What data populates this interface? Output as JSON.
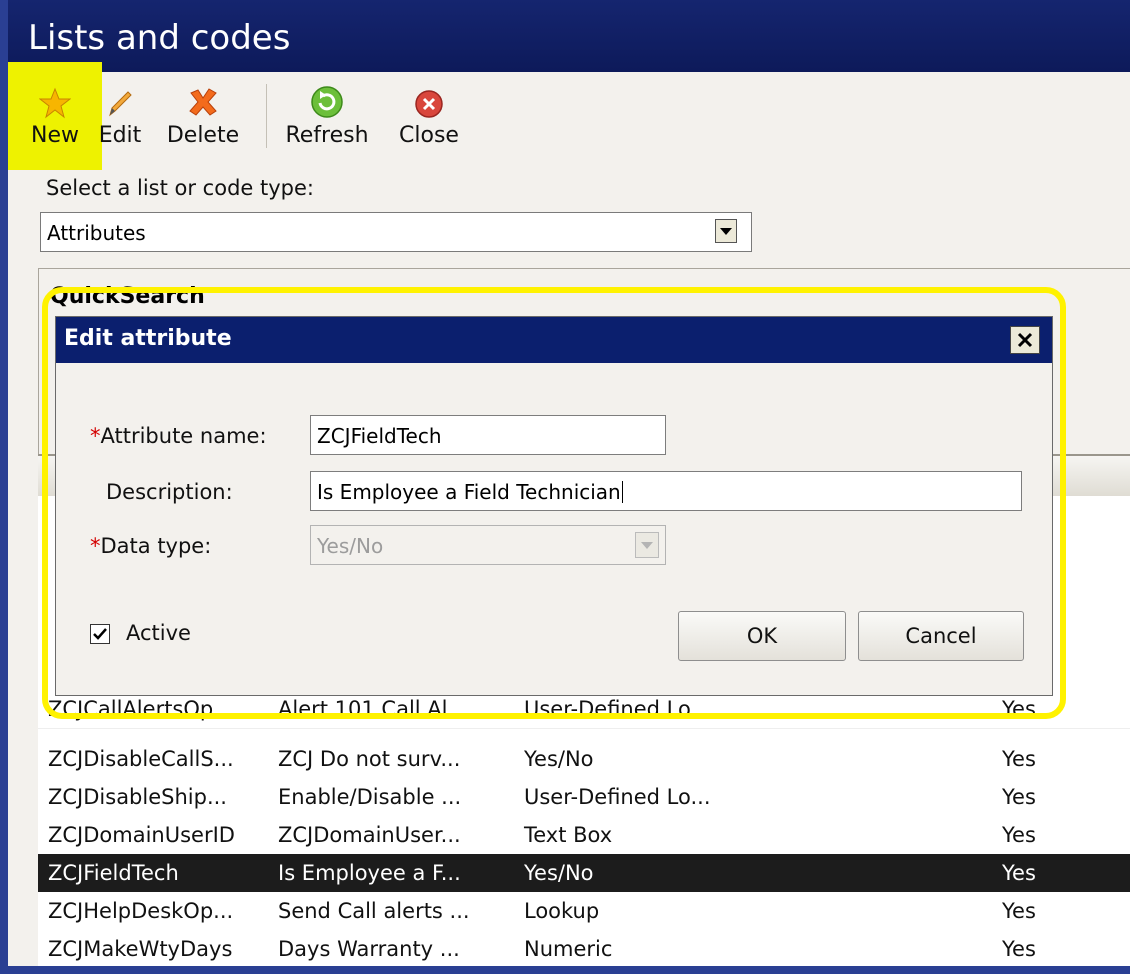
{
  "window": {
    "title": "Lists and codes"
  },
  "toolbar": {
    "new_label": "New",
    "edit_label": "Edit",
    "delete_label": "Delete",
    "refresh_label": "Refresh",
    "close_label": "Close"
  },
  "selector": {
    "label": "Select a list or code type:",
    "value": "Attributes"
  },
  "quicksearch": {
    "label": "QuickSearch"
  },
  "grid": {
    "rows": [
      {
        "c1": "ZCJCallAlertsOp...",
        "c2": "Alert 101 Call Al...",
        "c3": "User-Defined Lo...",
        "c4": "Yes",
        "selected": false
      },
      {
        "c1": "ZCJDisableCallS...",
        "c2": "ZCJ Do not surv...",
        "c3": "Yes/No",
        "c4": "Yes",
        "selected": false
      },
      {
        "c1": "ZCJDisableShip...",
        "c2": "Enable/Disable ...",
        "c3": "User-Defined Lo...",
        "c4": "Yes",
        "selected": false
      },
      {
        "c1": "ZCJDomainUserID",
        "c2": "ZCJDomainUser...",
        "c3": "Text Box",
        "c4": "Yes",
        "selected": false
      },
      {
        "c1": "ZCJFieldTech",
        "c2": "Is Employee a F...",
        "c3": "Yes/No",
        "c4": "Yes",
        "selected": true
      },
      {
        "c1": "ZCJHelpDeskOp...",
        "c2": "Send Call alerts ...",
        "c3": "Lookup",
        "c4": "Yes",
        "selected": false
      },
      {
        "c1": "ZCJMakeWtyDays",
        "c2": "Days Warranty ...",
        "c3": "Numeric",
        "c4": "Yes",
        "selected": false
      }
    ]
  },
  "dialog": {
    "title": "Edit attribute",
    "required_marker": "*",
    "name_label": "Attribute name:",
    "name_value": "ZCJFieldTech",
    "description_label": "Description:",
    "description_value": "Is Employee a Field Technician",
    "datatype_label": "Data type:",
    "datatype_value": "Yes/No",
    "active_label": "Active",
    "active_checked": true,
    "ok_label": "OK",
    "cancel_label": "Cancel"
  },
  "colors": {
    "title_bar": "#0d1a5a",
    "highlight": "#fff200",
    "required": "#d40000",
    "selected_row": "#1c1c1c"
  },
  "icons": [
    "star-icon",
    "pencil-icon",
    "delete-x-icon",
    "refresh-icon",
    "close-circle-icon",
    "close-x-icon",
    "check-icon",
    "dropdown-arrow-icon"
  ]
}
